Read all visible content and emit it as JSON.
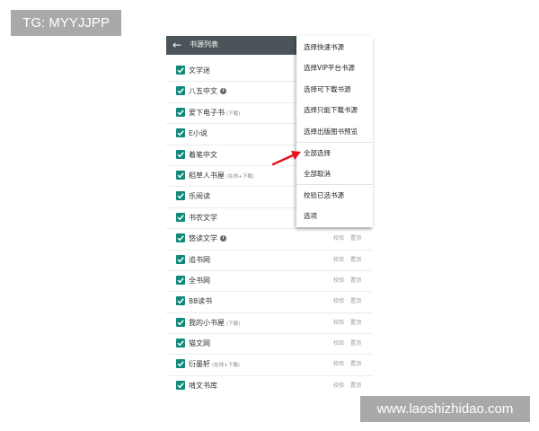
{
  "watermarks": {
    "top_left": "TG: MYYJJPP",
    "bottom_right": "www.laoshizhidao.com"
  },
  "toolbar": {
    "back_icon": "arrow-left-icon",
    "title": "书源列表"
  },
  "sources": [
    {
      "name": "文学迷",
      "tag": "",
      "info": false,
      "actions": false
    },
    {
      "name": "八五中文",
      "tag": "",
      "info": true,
      "actions": false
    },
    {
      "name": "爱下电子书",
      "tag": "(下载)",
      "info": false,
      "actions": false
    },
    {
      "name": "E小说",
      "tag": "",
      "info": false,
      "actions": false
    },
    {
      "name": "着笔中文",
      "tag": "",
      "info": false,
      "actions": false
    },
    {
      "name": "稻草人书屋",
      "tag": "(在线+下载)",
      "info": false,
      "actions": false
    },
    {
      "name": "乐阅读",
      "tag": "",
      "info": false,
      "actions": false
    },
    {
      "name": "书农文学",
      "tag": "",
      "info": false,
      "actions": false
    },
    {
      "name": "悠读文学",
      "tag": "",
      "info": true,
      "actions": true
    },
    {
      "name": "追书网",
      "tag": "",
      "info": false,
      "actions": true
    },
    {
      "name": "全书网",
      "tag": "",
      "info": false,
      "actions": true
    },
    {
      "name": "88读书",
      "tag": "",
      "info": false,
      "actions": true
    },
    {
      "name": "我的小书屋",
      "tag": "(下载)",
      "info": false,
      "actions": true
    },
    {
      "name": "猫文网",
      "tag": "",
      "info": false,
      "actions": true
    },
    {
      "name": "衍墨轩",
      "tag": "(在线+下载)",
      "info": false,
      "actions": true
    },
    {
      "name": "啃文书库",
      "tag": "",
      "info": false,
      "actions": true
    }
  ],
  "row_actions": {
    "verify": "校验",
    "pin": "置顶"
  },
  "menu": {
    "items": [
      "选择快速书源",
      "选择VIP平台书源",
      "选择可下载书源",
      "选择只能下载书源",
      "选择出版图书预览",
      "全部选择",
      "全部取消",
      "校验已选书源",
      "选项"
    ]
  },
  "colors": {
    "toolbar": "#4b5559",
    "checkbox": "#10897a",
    "arrow": "#e8101a",
    "watermark": "#a9a9a9"
  }
}
